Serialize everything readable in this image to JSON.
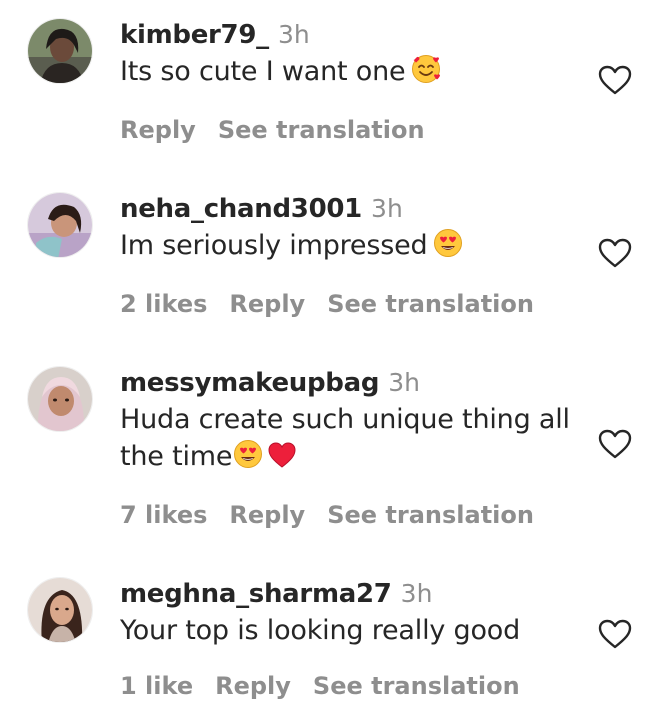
{
  "comments": [
    {
      "username": "kimber79_",
      "time": "3h",
      "text": "Its so cute I want one",
      "emojis": [
        "smiling-face-with-hearts-emoji"
      ],
      "likes": "",
      "reply_label": "Reply",
      "translate_label": "See translation"
    },
    {
      "username": "neha_chand3001",
      "time": "3h",
      "text": "Im seriously impressed",
      "emojis": [
        "heart-eyes-emoji"
      ],
      "likes": "2 likes",
      "reply_label": "Reply",
      "translate_label": "See translation"
    },
    {
      "username": "messymakeupbag",
      "time": "3h",
      "text_line1": "Huda create such unique thing all",
      "text_line2": "the time",
      "emojis": [
        "heart-eyes-emoji",
        "red-heart-emoji"
      ],
      "likes": "7 likes",
      "reply_label": "Reply",
      "translate_label": "See translation"
    },
    {
      "username": "meghna_sharma27",
      "time": "3h",
      "text": "Your top is looking really good",
      "emojis": [],
      "likes": "1 like",
      "reply_label": "Reply",
      "translate_label": "See translation"
    }
  ],
  "icons": {
    "like": "heart-outline-icon"
  },
  "colors": {
    "text": "#262626",
    "secondary": "#8e8e8e",
    "heart_red": "#ed1f3b",
    "emoji_yellow": "#ffc83d"
  }
}
